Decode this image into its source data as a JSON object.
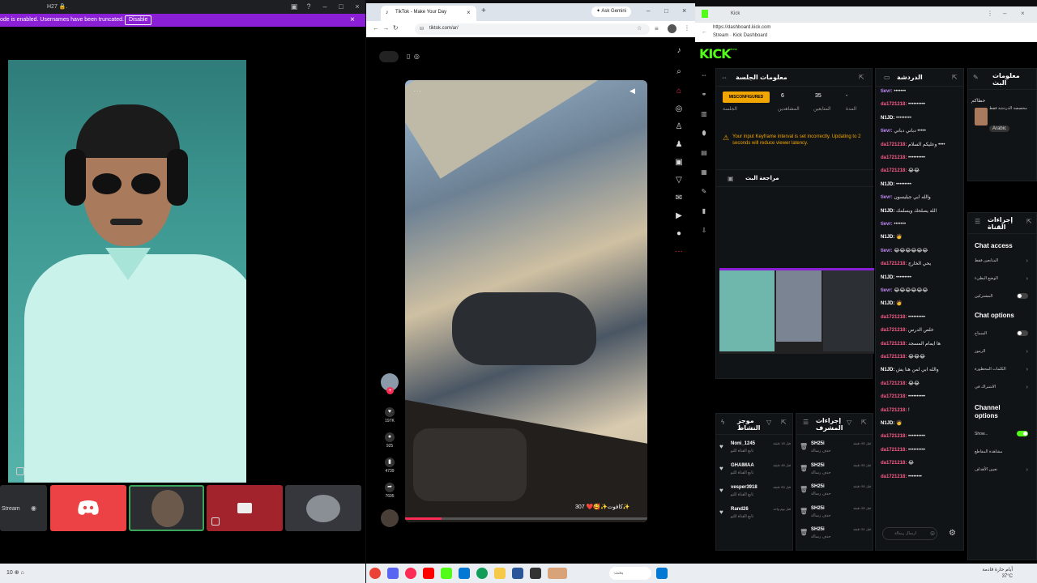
{
  "left_window": {
    "title": "H27 🔒.",
    "notice_text": "ode is enabled. Usernames have been truncated.",
    "notice_button": "Disable",
    "stream_tile_label": "Stream",
    "taskbar_text": "10 ⊕ ⌂"
  },
  "browser": {
    "tab_title": "TikTok - Make Your Day",
    "url": "tiktok.com/ar/",
    "gemini_label": "✦ Ask Gemini",
    "video_caption": "307 ❤️🥰✨كافوت✨",
    "actions": [
      {
        "icon": "heart-icon",
        "count": "197K"
      },
      {
        "icon": "comment-icon",
        "count": "925"
      },
      {
        "icon": "bookmark-icon",
        "count": "4739"
      },
      {
        "icon": "share-icon",
        "count": "7695"
      }
    ],
    "progress_fraction": 0.15
  },
  "kick": {
    "tab_title": "Kick",
    "url_line1": "https://dashboard.kick.com",
    "url_line2": "Stream · Kick Dashboard",
    "logo": "KICK",
    "logo_sup": "beta",
    "session": {
      "title": "معلومات الجلسة",
      "badge": "MISCONFIGURED",
      "badge_label": "الجلسة",
      "stats": [
        {
          "value": "6",
          "label": "المشاهدين"
        },
        {
          "value": "35",
          "label": "المتابعين"
        },
        {
          "value": "-",
          "label": "المدة"
        }
      ],
      "warning": "Your input Keyframe interval is set incorrectly. Updating to 2 seconds will reduce viewer latency.",
      "review_title": "مراجعة البث"
    },
    "chat": {
      "title": "الدردشة",
      "input_placeholder": "ارسال رسالة",
      "messages": [
        {
          "user": "tievr:",
          "text": "•••••••",
          "color": "#c48aff"
        },
        {
          "user": "da1721218:",
          "text": "••••••••••",
          "color": "#ff5a8a"
        },
        {
          "user": "N1JD:",
          "text": "•••••••••",
          "color": "#ffffff"
        },
        {
          "user": "tievr:",
          "text": "دباني دباني •••••",
          "color": "#c48aff"
        },
        {
          "user": "da1721218:",
          "text": "وعليكم السلام ••••",
          "color": "#ff5a8a"
        },
        {
          "user": "da1721218:",
          "text": "••••••••••",
          "color": "#ff5a8a"
        },
        {
          "user": "da1721218:",
          "text": "😂😂",
          "color": "#ff5a8a"
        },
        {
          "user": "N1JD:",
          "text": "•••••••••",
          "color": "#ffffff"
        },
        {
          "user": "tievr:",
          "text": "والله ابي جيليسون",
          "color": "#c48aff"
        },
        {
          "user": "N1JD:",
          "text": "الله يصلحك ويسلمك",
          "color": "#ffffff"
        },
        {
          "user": "tievr:",
          "text": "•••••••",
          "color": "#c48aff"
        },
        {
          "user": "N1JD:",
          "text": "🧑",
          "color": "#ffffff"
        },
        {
          "user": "tievr:",
          "text": "😂😂😂😂😂😂",
          "color": "#c48aff"
        },
        {
          "user": "da1721218:",
          "text": "يحي الخارج",
          "color": "#ff5a8a"
        },
        {
          "user": "N1JD:",
          "text": "•••••••••",
          "color": "#ffffff"
        },
        {
          "user": "tievr:",
          "text": "😂😂😂😂😂😂",
          "color": "#c48aff"
        },
        {
          "user": "N1JD:",
          "text": "🧑",
          "color": "#ffffff"
        },
        {
          "user": "da1721218:",
          "text": "••••••••••",
          "color": "#ff5a8a"
        },
        {
          "user": "da1721218:",
          "text": "خلص الدرس",
          "color": "#ff5a8a"
        },
        {
          "user": "da1721218:",
          "text": "ها ايمام المسجد",
          "color": "#ff5a8a"
        },
        {
          "user": "da1721218:",
          "text": "😂😂😂",
          "color": "#ff5a8a"
        },
        {
          "user": "N1JD:",
          "text": "والله ابي لمن هنا يش",
          "color": "#ffffff"
        },
        {
          "user": "da1721218:",
          "text": "😂😂",
          "color": "#ff5a8a"
        },
        {
          "user": "da1721218:",
          "text": "••••••••••",
          "color": "#ff5a8a"
        },
        {
          "user": "da1721218:",
          "text": "!",
          "color": "#ff5a8a"
        },
        {
          "user": "N1JD:",
          "text": "🧑",
          "color": "#ffffff"
        },
        {
          "user": "da1721218:",
          "text": "••••••••••",
          "color": "#ff5a8a"
        },
        {
          "user": "da1721218:",
          "text": "••••••••••",
          "color": "#ff5a8a"
        },
        {
          "user": "da1721218:",
          "text": "😂",
          "color": "#ff5a8a"
        },
        {
          "user": "da1721218:",
          "text": "••••••••",
          "color": "#ff5a8a"
        }
      ]
    },
    "info": {
      "title": "معلومات البث",
      "name": "حطاكم",
      "category": "مخصصة الدردشة فقط",
      "language": "Arabic"
    },
    "mod": {
      "title": "إجراءات القناة",
      "chat_access": "Chat access",
      "chat_options": "Chat options",
      "channel_options": "Channel options",
      "row1": "المتابعين فقط",
      "row2": "الوضع البطيء",
      "row3": "المشتركين",
      "row4": "السماح",
      "row5": "الرموز",
      "row6": "الكلمات المحظورة",
      "row7": "الاشتراك في",
      "row8": "Show...",
      "row9": "مشاهدة المقاطع",
      "row10": "تعيين الأهداف"
    },
    "recent": {
      "title": "موجز النشاط",
      "events": [
        {
          "name": "Noni_1245",
          "sub": "تابع القناة للتو",
          "time": "قبل 18 دقيقة"
        },
        {
          "name": "GHAIMAA",
          "sub": "تابع القناة للتو",
          "time": "قبل 48 دقيقة"
        },
        {
          "name": "vesper3918",
          "sub": "تابع القناة للتو",
          "time": "قبل 50 دقيقة"
        },
        {
          "name": "Rand26",
          "sub": "تابع القناة للتو",
          "time": "قبل يوم واحد"
        }
      ]
    },
    "modactions": {
      "title": "إجراءات المشرف",
      "events": [
        {
          "name": "SH25i",
          "sub": "حذف رسالة",
          "time": "قبل 50 دقيقة"
        },
        {
          "name": "SH25i",
          "sub": "حذف رسالة",
          "time": "قبل 50 دقيقة"
        },
        {
          "name": "SH25i",
          "sub": "حذف رسالة",
          "time": "قبل 50 دقيقة"
        },
        {
          "name": "SH25i",
          "sub": "حذف رسالة",
          "time": "قبل 50 دقيقة"
        },
        {
          "name": "SH25i",
          "sub": "حذف رسالة",
          "time": "قبل 51 دقيقة"
        }
      ]
    }
  },
  "taskbar": {
    "search": "بحث",
    "clock": "أيام حارة قادمة\n37°C"
  }
}
